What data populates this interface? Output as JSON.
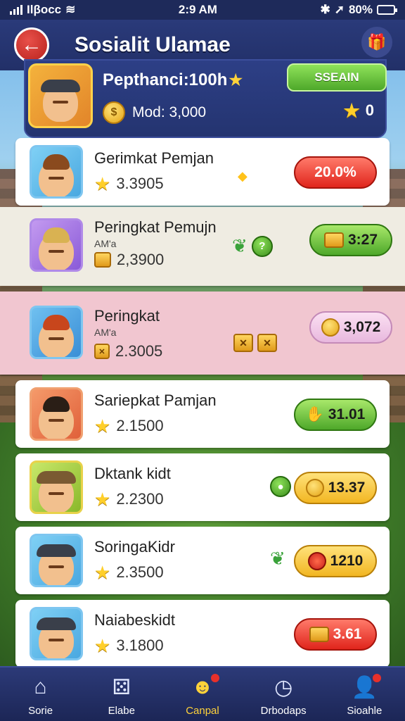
{
  "status_bar": {
    "carrier": "Ilβocc",
    "time": "2:9 AM",
    "battery": "80%",
    "battery_level": 0.8
  },
  "header": {
    "title": "Sosialit Ulamae",
    "back_icon": "back-arrow-icon",
    "settings_icon": "gift-icon"
  },
  "profile": {
    "name": "Pepthanci:100h",
    "search_label": "SSEAIN",
    "coins": "Mod: 3,000",
    "stars": "0"
  },
  "rows": [
    {
      "name": "Gerimkat Pemjan",
      "sub": "",
      "score": "3.3905",
      "value": "20.0%"
    },
    {
      "name": "Peringkat Pemujn",
      "sub": "AM'a",
      "score": "2,3900",
      "value": "3:27"
    },
    {
      "name": "Peringkat",
      "sub": "AM'a",
      "score": "2.3005",
      "value": "3,072"
    },
    {
      "name": "Sariepkat Pamjan",
      "sub": "",
      "score": "2.1500",
      "value": "31.01"
    },
    {
      "name": "Dktank kidt",
      "sub": "",
      "score": "2.2300",
      "value": "13.37"
    },
    {
      "name": "SoringaKidr",
      "sub": "",
      "score": "2.3500",
      "value": "1210"
    },
    {
      "name": "Naiabeskidt",
      "sub": "",
      "score": "3.1800",
      "value": "3.61"
    }
  ],
  "nav": [
    {
      "label": "Sorie",
      "icon": "home-icon"
    },
    {
      "label": "Elabe",
      "icon": "dice-icon"
    },
    {
      "label": "Canpal",
      "icon": "game-icon"
    },
    {
      "label": "Drbodaps",
      "icon": "clock-icon"
    },
    {
      "label": "Sioahle",
      "icon": "profile-icon"
    }
  ],
  "colors": {
    "header": "#223068",
    "accent_green": "#4ea82a",
    "accent_red": "#e0251c",
    "highlight_row": "#f1c6d0"
  }
}
